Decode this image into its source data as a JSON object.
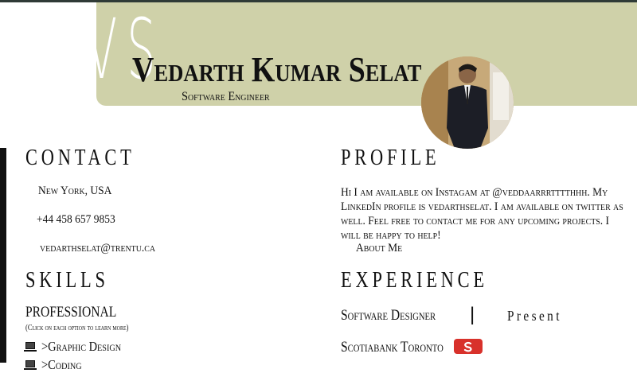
{
  "header": {
    "initials": "VS",
    "name": "Vedarth Kumar Selat",
    "role": "Software Engineer"
  },
  "contact": {
    "title": "CONTACT",
    "location": "New York, USA",
    "phone": "+44 458 657 9853",
    "email": "vedarthselat@trentu.ca"
  },
  "profile": {
    "title": "PROFILE",
    "text": "Hi I am available on Instagam at @veddaarrrtttthhh. My LinkedIn profile is vedarthselat. I am available on twitter as well. Feel free to contact me for any upcoming projects. I will be happy to help!",
    "about_link": "About Me"
  },
  "skills": {
    "title": "SKILLS",
    "subtitle": "PROFESSIONAL",
    "hint": "(Click on each option to learn more)",
    "items": [
      {
        "label": ">Graphic Design",
        "icon": "laptop-icon"
      },
      {
        "label": ">Coding",
        "icon": "laptop-icon"
      }
    ]
  },
  "experience": {
    "title": "EXPERIENCE",
    "role": "Software Designer",
    "separator": "|",
    "period": "Present",
    "company": "Scotiabank Toronto",
    "company_icon": "scotiabank-logo-icon"
  },
  "colors": {
    "banner": "#cfd1a9",
    "topline": "#2f3a36",
    "bank_red": "#d8312b"
  }
}
